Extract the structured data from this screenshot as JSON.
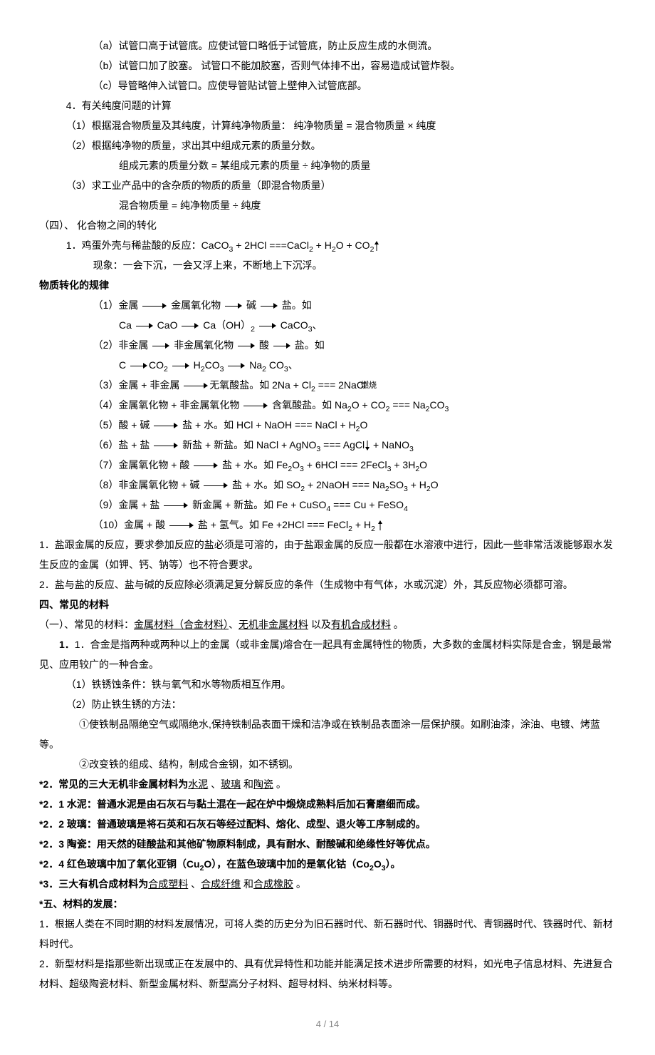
{
  "l1": "（a）试管口高于试管底。应使试管口略低于试管底，防止反应生成的水倒流。",
  "l2": "（b）试管口加了胶塞。 试管口不能加胶塞，否则气体排不出，容易造成试管炸裂。",
  "l3": "（c）导管略伸入试管口。应使导管贴试管上壁伸入试管底部。",
  "l4": "4．有关纯度问题的计算",
  "l5": "（1）根据混合物质量及其纯度，计算纯净物质量：  纯净物质量 = 混合物质量 × 纯度",
  "l6": "（2）根据纯净物的质量，求出其中组成元素的质量分数。",
  "l7": "组成元素的质量分数 = 某组成元素的质量 ÷ 纯净物的质量",
  "l8": "（3）求工业产品中的含杂质的物质的质量（即混合物质量）",
  "l9": "混合物质量 = 纯净物质量 ÷ 纯度",
  "l10": "（四）、 化合物之间的转化",
  "l11a": "1．鸡蛋外壳与稀盐酸的反应：CaCO",
  "l11b": " + 2HCl ===CaCl",
  "l11c": " + H",
  "l11d": "O + CO",
  "l12": "现象：一会下沉，一会又浮上来，不断地上下沉浮。",
  "h1": "物质转化的规律",
  "r1a": "（1）金属 ",
  "r1b": " 金属氧化物 ",
  "r1c": " 碱 ",
  "r1d": " 盐。如",
  "r1e": "Ca ",
  "r1f": " CaO ",
  "r1g": " Ca（OH）",
  "r1h": " ",
  "r1i": " CaCO",
  "r2a": "（2）非金属 ",
  "r2b": " 非金属氧化物 ",
  "r2c": " 酸 ",
  "r2d": " 盐。如",
  "r2e": "C ",
  "r2f": "CO",
  "r2g": " ",
  "r2h": " H",
  "r2i": "CO",
  "r2j": " ",
  "r2k": " Na",
  "r2l": " CO",
  "r3a": "（3）金属 + 非金属 ",
  "r3b": "无氧酸盐。如 2Na + Cl",
  "r3c": " === 2NaCl",
  "r3lab": "燃烧",
  "r4a": "（4）金属氧化物 + 非金属氧化物  ",
  "r4b": " 含氧酸盐。如 Na",
  "r4c": "O + CO",
  "r4d": " === Na",
  "r4e": "CO",
  "r5a": "（5）酸 + 碱  ",
  "r5b": " 盐 + 水。如 HCl + NaOH === NaCl + H",
  "r5c": "O",
  "r6a": "（6）盐 + 盐 ",
  "r6b": " 新盐 + 新盐。如 NaCl + AgNO",
  "r6c": "  === AgCl",
  "r6d": " + NaNO",
  "r7a": "（7）金属氧化物 + 酸 ",
  "r7b": " 盐 + 水。如 Fe",
  "r7c": "O",
  "r7d": " + 6HCl === 2FeCl",
  "r7e": " + 3H",
  "r7f": "O",
  "r8a": "（8）非金属氧化物 + 碱 ",
  "r8b": " 盐 + 水。如 SO",
  "r8c": " + 2NaOH === Na",
  "r8d": "SO",
  "r8e": " + H",
  "r8f": "O",
  "r9a": "（9）金属 + 盐 ",
  "r9b": " 新金属 + 新盐。如 Fe + CuSO",
  "r9c": " === Cu + FeSO",
  "r10a": "（10）金属 + 酸 ",
  "r10b": " 盐 + 氢气。如 Fe +2HCl === FeCl",
  "r10c": " + H",
  "p1": "1．盐跟金属的反应，要求参加反应的盐必须是可溶的，由于盐跟金属的反应一般都在水溶液中进行，因此一些非常活泼能够跟水发生反应的金属（如钾、钙、钠等）也不符合要求。",
  "p2": "2．盐与盐的反应、盐与碱的反应除必须满足复分解反应的条件（生成物中有气体，水或沉淀）外，其反应物必须都可溶。",
  "h2": "四、常见的材料",
  "m1a": "（一）、常见的材料：",
  "m1b": "金属材料（合金材料）",
  "m1c": "、",
  "m1d": "无机非金属材料",
  "m1e": " 以及",
  "m1f": "有机合成材料",
  "m1g": " 。",
  "m2": "1．合金是指两种或两种以上的金属（或非金属)熔合在一起具有金属特性的物质，大多数的金属材料实际是合金，钢是最常见、应用较广的一种合金。",
  "m3": "（1）铁锈蚀条件：铁与氧气和水等物质相互作用。",
  "m4": "（2）防止铁生锈的方法：",
  "m5": "①使铁制品隔绝空气或隔绝水,保持铁制品表面干燥和洁净或在铁制品表面涂一层保护膜。如刷油漆，涂油、电镀、烤蓝等。",
  "m6": "②改变铁的组成、结构，制成合金钢，如不锈钢。",
  "m7a": "*2．常见的三大无机非金属材料为",
  "m7b": "水泥",
  "m7c": " 、",
  "m7d": "玻璃",
  "m7e": " 和",
  "m7f": "陶瓷",
  "m7g": " 。",
  "m8": "*2．1  水泥：普通水泥是由石灰石与黏土混在一起在炉中煅烧成熟料后加石膏磨细而成。",
  "m9": "*2．2  玻璃：普通玻璃是将石英和石灰石等经过配料、熔化、成型、退火等工序制成的。",
  "m10": "*2．3  陶瓷：用天然的硅酸盐和其他矿物原料制成，具有耐水、耐酸碱和绝缘性好等优点。",
  "m11a": "*2．4  红色玻璃中加了氧化亚铜（Cu",
  "m11b": "O），在蓝色玻璃中加的是氧化钴（Co",
  "m11c": "O",
  "m11d": "）。",
  "m12a": "*3．三大有机合成材料为",
  "m12b": "合成塑料",
  "m12c": " 、",
  "m12d": "合成纤维",
  "m12e": " 和",
  "m12f": "合成橡胶",
  "m12g": " 。",
  "h3": "*五、材料的发展：",
  "d1": "1．根据人类在不同时期的材料发展情况，可将人类的历史分为旧石器时代、新石器时代、铜器时代、青铜器时代、铁器时代、新材料时代。",
  "d2": "2．新型材料是指那些新出现或正在发展中的、具有优异特性和功能并能满足技术进步所需要的材料，如光电子信息材料、先进复合材料、超级陶瓷材料、新型金属材料、新型高分子材料、超导材料、纳米材料等。",
  "footer": "4 / 14"
}
